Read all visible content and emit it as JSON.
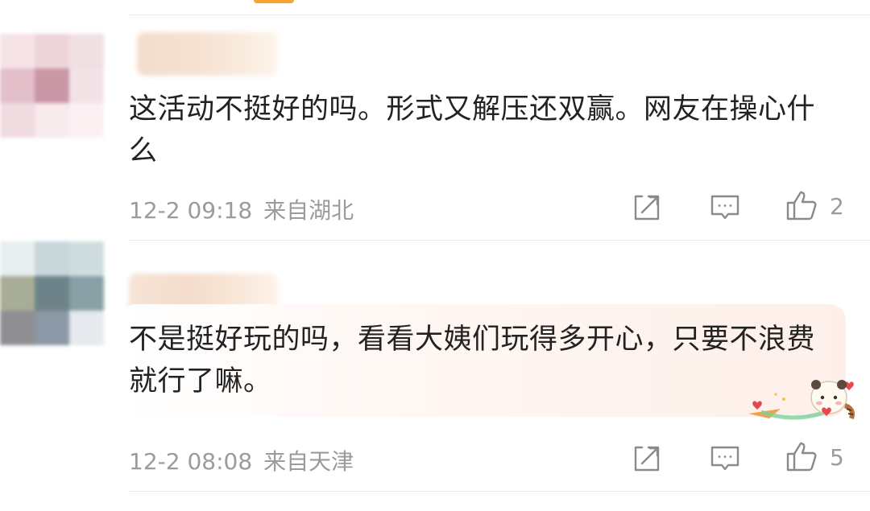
{
  "comments": [
    {
      "text": "这活动不挺好的吗。形式又解压还双赢。网友在操心什么",
      "time": "12-2 09:18",
      "location": "来自湖北",
      "like_count": "2",
      "avatar_colors": [
        "#f5e3e6",
        "#ecd5da",
        "#f0e0e3",
        "#e3bfca",
        "#c997a6",
        "#f3e3e7",
        "#f0dbe0",
        "#f7eaed",
        "#fbf0f2"
      ]
    },
    {
      "text": "不是挺好玩的吗，看看大姨们玩得多开心，只要不浪费就行了嘛。",
      "time": "12-2 08:08",
      "location": "来自天津",
      "like_count": "5",
      "avatar_colors": [
        "#e7eef0",
        "#c8d6da",
        "#cfdde0",
        "#a8ad97",
        "#6e8389",
        "#89a0a6",
        "#8f8f92",
        "#8b98a5",
        "#e6e9ed"
      ]
    }
  ],
  "icons": {
    "share": "share-icon",
    "comment": "comment-icon",
    "like": "like-icon"
  },
  "colors": {
    "meta_text": "#9b9b9b",
    "body_text": "#222222",
    "icon_stroke": "#8a8a8a"
  }
}
